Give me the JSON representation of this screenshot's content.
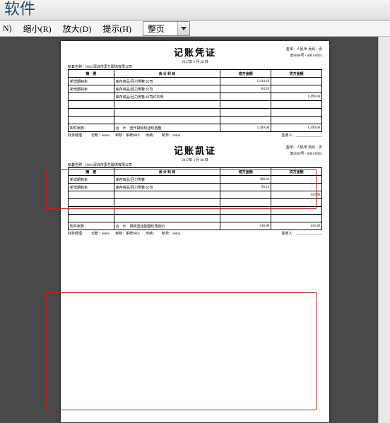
{
  "app_title": "软件",
  "menu": {
    "shrink": "缩小(R)",
    "enlarge": "放大(D)",
    "hint": "提示(H)",
    "mode_label": "整页",
    "prefix_n": "N)"
  },
  "vouchers": [
    {
      "title": "记账凭证",
      "date": "2017年 3 月 28 日",
      "right1": "金单：人民币  页码：页",
      "right2": "旧0008号  - 0001/0001",
      "company": "帐套名称：[001]深圳市里艺服饰有限公司",
      "cols": {
        "c1": "摘　要",
        "c2": "会 计 科 目",
        "c3": "借方金额",
        "c4": "贷方金额"
      },
      "rows": [
        {
          "a": "新增期初余",
          "b": "库存商品/回力男鞋/公司",
          "d": "1,414.18",
          "c": ""
        },
        {
          "a": "新增期初余",
          "b": "库存商品/回力男鞋/公司",
          "d": "84.26",
          "c": ""
        },
        {
          "a": "",
          "b": "库存商品/回力男鞋/公司红灰男",
          "d": "",
          "c": "1,499.00"
        },
        {
          "a": "",
          "b": "",
          "d": "",
          "c": ""
        },
        {
          "a": "",
          "b": "",
          "d": "",
          "c": ""
        },
        {
          "a": "",
          "b": "",
          "d": "",
          "c": ""
        }
      ],
      "total": {
        "a": "附件张数：",
        "b": "合　计　壹仟肆佰玖拾玖圆整",
        "d": "1,499.00",
        "c": "1,499.00"
      },
      "footer": {
        "a": "财务经理：",
        "b": "记账：demo",
        "c": "审核：系统0001",
        "d": "出纳：",
        "e": "制单：demo",
        "f": "签收人：_______________"
      }
    },
    {
      "title": "记账凯证",
      "date": "2017年 3 月 28 日",
      "right1": "金单：人民币  页码：页",
      "right2": "旧0009号  - 0001/0001",
      "company": "帐套名称：[001]深圳市里艺服饰有限公司",
      "cols": {
        "c1": "摘　要",
        "c2": "会 计 科 目",
        "c3": "借方金额",
        "c4": "贷方金额"
      },
      "rows": [
        {
          "a": "新增期初余",
          "b": "库存商品/回力男鞋",
          "d": "388.84",
          "c": ""
        },
        {
          "a": "新增期初余",
          "b": "库存商品/回力男鞋/公司",
          "d": "90.14",
          "c": ""
        },
        {
          "a": "",
          "b": "",
          "d": "",
          "c": "418.98"
        },
        {
          "a": "",
          "b": "",
          "d": "",
          "c": ""
        },
        {
          "a": "",
          "b": "",
          "d": "",
          "c": ""
        },
        {
          "a": "",
          "b": "",
          "d": "",
          "c": ""
        }
      ],
      "total": {
        "a": "附件张数：",
        "b": "合　计　肆佰壹拾捌圆玖角捌分",
        "d": "418.98",
        "c": "418.98"
      },
      "footer": {
        "a": "财务经理：",
        "b": "记账：demo",
        "c": "审核：系统0001",
        "d": "出纳：",
        "e": "制单：demo",
        "f": "签收人：_______________"
      }
    }
  ]
}
